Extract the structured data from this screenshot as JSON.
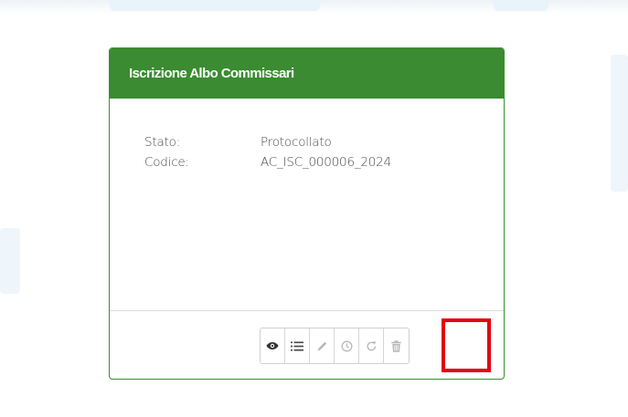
{
  "card": {
    "title": "Iscrizione Albo Commissari",
    "fields": [
      {
        "label": "Stato:",
        "value": "Protocollato"
      },
      {
        "label": "Codice:",
        "value": "AC_ISC_000006_2024"
      }
    ]
  },
  "toolbar": {
    "buttons": [
      {
        "icon": "eye-icon",
        "enabled": true
      },
      {
        "icon": "list-icon",
        "enabled": true
      },
      {
        "icon": "pencil-icon",
        "enabled": false
      },
      {
        "icon": "clock-icon",
        "enabled": false
      },
      {
        "icon": "redo-icon",
        "enabled": false
      },
      {
        "icon": "trash-icon",
        "enabled": false,
        "highlighted": true
      }
    ]
  },
  "colors": {
    "header_bg": "#3a8b31",
    "card_border": "#3b8f31",
    "highlight": "#e3000f",
    "icon_enabled": "#333333",
    "icon_disabled": "#b8b8b8"
  }
}
